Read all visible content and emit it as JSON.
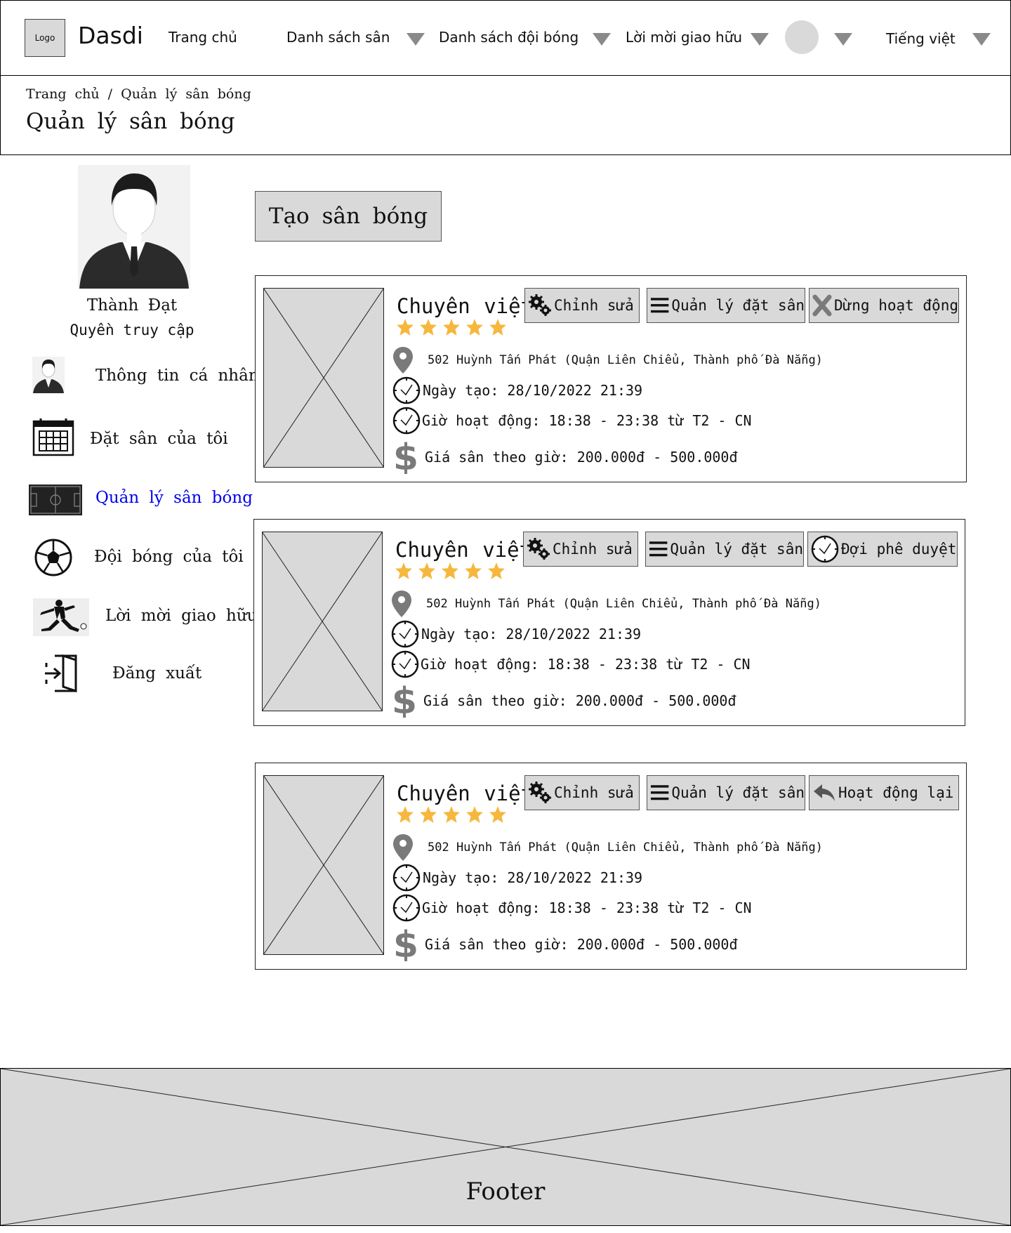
{
  "header": {
    "logo_text": "Logo",
    "brand": "Dasdi",
    "nav": [
      "Trang chủ",
      "Danh sách sân",
      "Danh sách đội bóng",
      "Lời mời giao hữu"
    ],
    "language": "Tiếng việt"
  },
  "breadcrumb": "Trang chủ / Quản lý sân bóng",
  "page_title": "Quản lý sân bóng",
  "profile": {
    "name": "Thành Đạt",
    "role": "Quyền truy cập"
  },
  "sidebar": {
    "items": [
      {
        "label": "Thông tin cá nhân",
        "icon": "user-icon"
      },
      {
        "label": "Đặt sân của tôi",
        "icon": "calendar-icon"
      },
      {
        "label": "Quản lý sân bóng",
        "icon": "field-icon",
        "active": true
      },
      {
        "label": "Đội bóng của tôi",
        "icon": "soccer-ball-icon"
      },
      {
        "label": "Lời mời giao hữu",
        "icon": "player-kick-icon"
      },
      {
        "label": "Đăng xuất",
        "icon": "logout-icon"
      }
    ],
    "active_color": "#0000ee"
  },
  "create_button": "Tạo sân bóng",
  "cards": [
    {
      "name": "Chuyên việt",
      "rating": 5,
      "edit": "Chỉnh sửa",
      "manage": "Quản lý đặt sân",
      "status_action": "Dừng hoạt động",
      "status_icon": "close-icon",
      "address": "502 Huỳnh Tấn Phát (Quận Liên Chiểu, Thành phố Đà Nẵng)",
      "created": "Ngày tạo: 28/10/2022 21:39",
      "hours": "Giờ hoạt động: 18:38 - 23:38 từ T2 - CN",
      "price": "Giá sân theo giờ: 200.000đ - 500.000đ"
    },
    {
      "name": "Chuyên việt",
      "rating": 5,
      "edit": "Chỉnh sửa",
      "manage": "Quản lý đặt sân",
      "status_action": "Đợi phê duyệt",
      "status_icon": "clock-icon",
      "address": "502 Huỳnh Tấn Phát (Quận Liên Chiểu, Thành phố Đà Nẵng)",
      "created": "Ngày tạo: 28/10/2022 21:39",
      "hours": "Giờ hoạt động: 18:38 - 23:38 từ T2 - CN",
      "price": "Giá sân theo giờ: 200.000đ - 500.000đ"
    },
    {
      "name": "Chuyên việt",
      "rating": 5,
      "edit": "Chỉnh sửa",
      "manage": "Quản lý đặt sân",
      "status_action": "Hoạt động lại",
      "status_icon": "reply-icon",
      "address": "502 Huỳnh Tấn Phát (Quận Liên Chiểu, Thành phố Đà Nẵng)",
      "created": "Ngày tạo: 28/10/2022 21:39",
      "hours": "Giờ hoạt động: 18:38 - 23:38 từ T2 - CN",
      "price": "Giá sân theo giờ: 200.000đ - 500.000đ"
    }
  ],
  "footer": "Footer",
  "colors": {
    "placeholder_gray": "#d9d9d9",
    "star": "#f6b73c",
    "icon_gray": "#8a8a8a"
  }
}
